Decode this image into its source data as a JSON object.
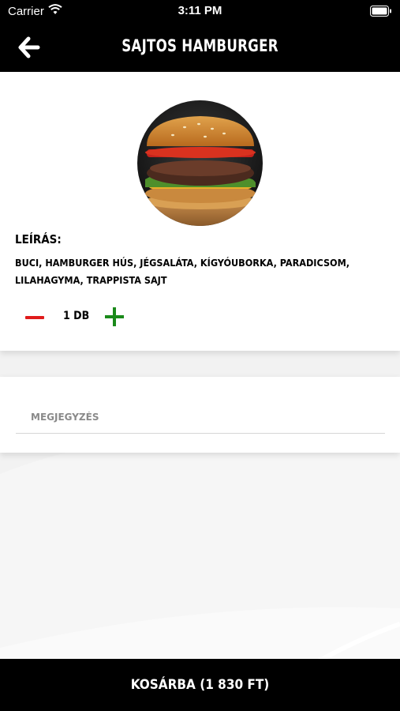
{
  "status_bar": {
    "carrier": "Carrier",
    "time": "3:11 PM",
    "wifi_icon": "wifi-icon",
    "battery_icon": "battery-icon"
  },
  "nav": {
    "title": "SAJTOS HAMBURGER",
    "back_icon": "arrow-left-icon"
  },
  "product": {
    "image": "burger-photo",
    "description_label": "LEÍRÁS:",
    "description": "BUCI, HAMBURGER HÚS, JÉGSALÁTA, KÍGYÓUBORKA, PARADICSOM, LILAHAGYMA, TRAPPISTA SAJT",
    "quantity_text": "1 DB",
    "minus_icon": "minus-icon",
    "plus_icon": "plus-icon"
  },
  "note": {
    "placeholder": "MEGJEGYZÉS",
    "value": ""
  },
  "cart_button": {
    "label": "KOSÁRBA (1 830 FT)"
  },
  "colors": {
    "bar_background": "#000000",
    "minus": "#e01b1b",
    "plus": "#1a8a1a",
    "page_background": "#f2f2f2"
  }
}
